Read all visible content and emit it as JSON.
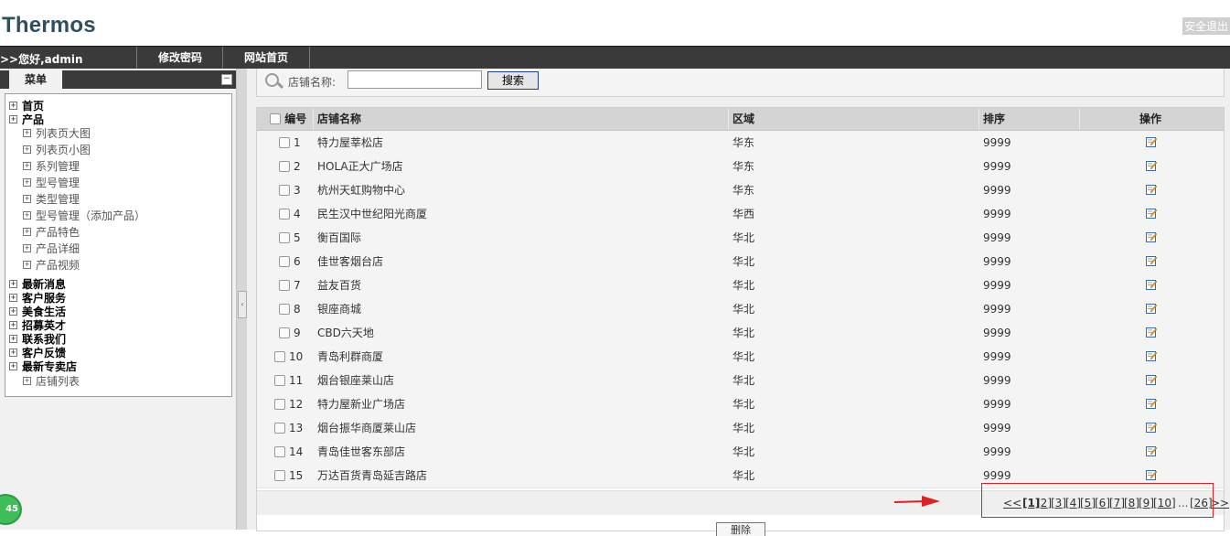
{
  "app": {
    "logo": "Thermos",
    "logout_label": "安全退出"
  },
  "topnav": {
    "greeting": ">>您好,admin",
    "change_password": "修改密码",
    "site_home": "网站首页"
  },
  "sidebar": {
    "menu_title": "菜单",
    "collapse_icon": "minus-box-icon",
    "tree": [
      {
        "label": "首页",
        "level": 0
      },
      {
        "label": "产品",
        "level": 0
      },
      {
        "label": "列表页大图",
        "level": 1
      },
      {
        "label": "列表页小图",
        "level": 1
      },
      {
        "label": "系列管理",
        "level": 1
      },
      {
        "label": "型号管理",
        "level": 1
      },
      {
        "label": "类型管理",
        "level": 1
      },
      {
        "label": "型号管理（添加产品）",
        "level": 1
      },
      {
        "label": "产品特色",
        "level": 1
      },
      {
        "label": "产品详细",
        "level": 1
      },
      {
        "label": "产品视频",
        "level": 1
      },
      {
        "label": "最新消息",
        "level": 0
      },
      {
        "label": "客户服务",
        "level": 0
      },
      {
        "label": "美食生活",
        "level": 0
      },
      {
        "label": "招募英才",
        "level": 0
      },
      {
        "label": "联系我们",
        "level": 0
      },
      {
        "label": "客户反馈",
        "level": 0
      },
      {
        "label": "最新专卖店",
        "level": 0
      },
      {
        "label": "店铺列表",
        "level": 1
      }
    ]
  },
  "search": {
    "label": "店铺名称:",
    "value": "",
    "button": "搜索"
  },
  "table": {
    "columns": [
      "编号",
      "店铺名称",
      "区域",
      "排序",
      "操作"
    ],
    "rows": [
      {
        "id": "1",
        "name": "特力屋莘松店",
        "region": "华东",
        "sort": "9999"
      },
      {
        "id": "2",
        "name": "HOLA正大广场店",
        "region": "华东",
        "sort": "9999"
      },
      {
        "id": "3",
        "name": "杭州天虹购物中心",
        "region": "华东",
        "sort": "9999"
      },
      {
        "id": "4",
        "name": "民生汉中世纪阳光商厦",
        "region": "华西",
        "sort": "9999"
      },
      {
        "id": "5",
        "name": "衡百国际",
        "region": "华北",
        "sort": "9999"
      },
      {
        "id": "6",
        "name": "佳世客烟台店",
        "region": "华北",
        "sort": "9999"
      },
      {
        "id": "7",
        "name": "益友百货",
        "region": "华北",
        "sort": "9999"
      },
      {
        "id": "8",
        "name": "银座商城",
        "region": "华北",
        "sort": "9999"
      },
      {
        "id": "9",
        "name": "CBD六天地",
        "region": "华北",
        "sort": "9999"
      },
      {
        "id": "10",
        "name": "青岛利群商厦",
        "region": "华北",
        "sort": "9999"
      },
      {
        "id": "11",
        "name": "烟台银座莱山店",
        "region": "华北",
        "sort": "9999"
      },
      {
        "id": "12",
        "name": "特力屋新业广场店",
        "region": "华北",
        "sort": "9999"
      },
      {
        "id": "13",
        "name": "烟台振华商厦莱山店",
        "region": "华北",
        "sort": "9999"
      },
      {
        "id": "14",
        "name": "青岛佳世客东部店",
        "region": "华北",
        "sort": "9999"
      },
      {
        "id": "15",
        "name": "万达百货青岛延吉路店",
        "region": "华北",
        "sort": "9999"
      }
    ],
    "action_icon": "edit-icon"
  },
  "pagination": {
    "prev": "<<",
    "pages": [
      "[1]",
      "[2]",
      "[3]",
      "[4]",
      "[5]",
      "[6]",
      "[7]",
      "[8]",
      "[9]",
      "[10]"
    ],
    "current": "[1]",
    "ellipsis": "...",
    "last": "[26]",
    "next": ">>"
  },
  "delete_button": "删除",
  "badge": "45",
  "colors": {
    "nav_bg": "#3a3a3a",
    "logo": "#2f4f5f",
    "annotation": "#e02020",
    "row_bg": "#f4f4f4"
  }
}
